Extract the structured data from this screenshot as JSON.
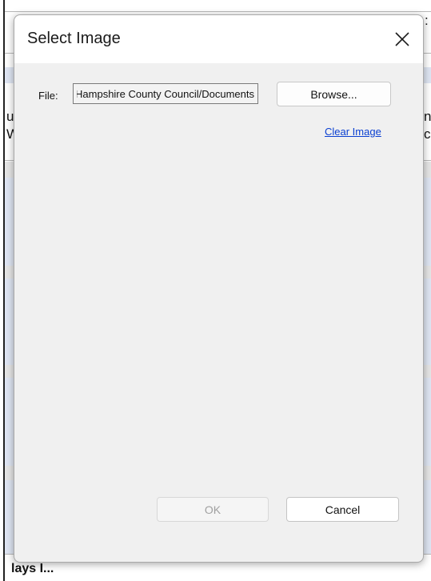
{
  "background": {
    "fragments": {
      "top_right": ":",
      "left_1": "u",
      "left_2": "W",
      "right_1": "n",
      "right_2": "c"
    },
    "bottom_text": "lays I..."
  },
  "dialog": {
    "title": "Select Image",
    "close_icon": "close-icon",
    "file_label": "File:",
    "file_value": "Hampshire County Council/Documents",
    "browse_label": "Browse...",
    "clear_label": "Clear Image",
    "ok_label": "OK",
    "cancel_label": "Cancel"
  },
  "colors": {
    "dialog_bg": "#f0f0f0",
    "link": "#0a3fd1",
    "disabled_text": "#a0a0a0"
  }
}
